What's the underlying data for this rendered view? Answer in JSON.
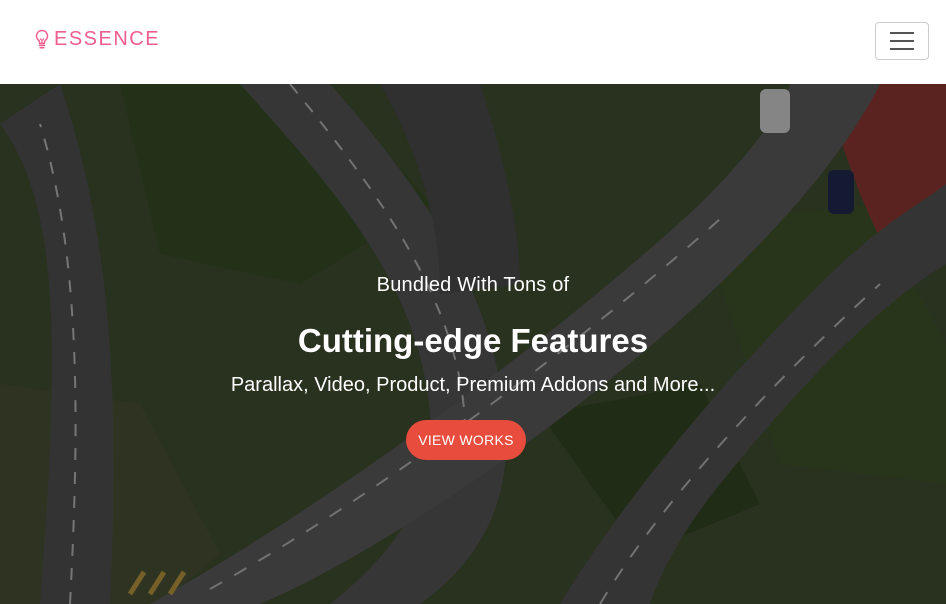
{
  "brand": {
    "name": "ESSENCE",
    "color": "#ef5d8f",
    "icon": "lightbulb-icon"
  },
  "nav": {
    "toggler_icon": "hamburger-menu-icon"
  },
  "hero": {
    "pre_title": "Bundled With Tons of",
    "title": "Cutting-edge Features",
    "subtitle": "Parallax, Video, Product, Premium Addons and More...",
    "button_label": "VIEW WORKS",
    "button_color": "#e74c3c",
    "background_description_icon": "highway-interchange-image"
  }
}
